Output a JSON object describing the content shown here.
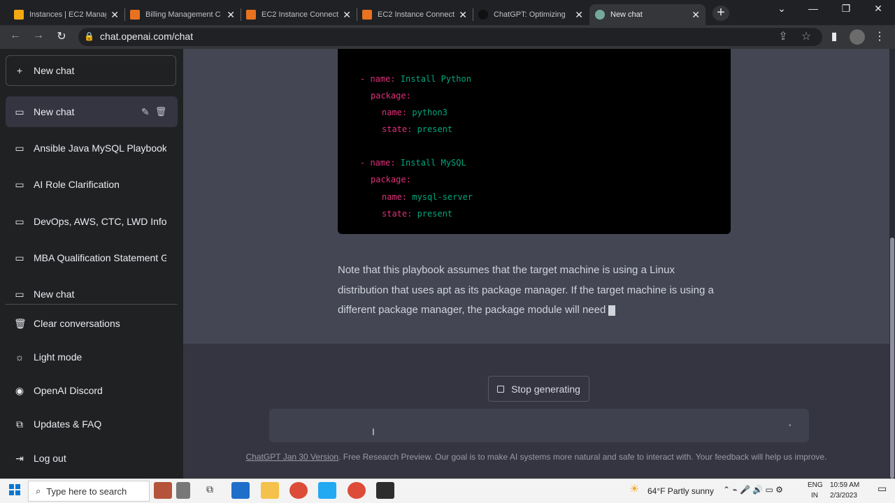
{
  "browser": {
    "tabs": [
      {
        "title": "Instances | EC2 Manag",
        "icon": "aws-icon",
        "color": "#f3a712"
      },
      {
        "title": "Billing Management C",
        "icon": "aws-icon",
        "color": "#e8721f"
      },
      {
        "title": "EC2 Instance Connect",
        "icon": "aws-icon",
        "color": "#e8721f"
      },
      {
        "title": "EC2 Instance Connect",
        "icon": "aws-icon",
        "color": "#e8721f"
      },
      {
        "title": "ChatGPT: Optimizing",
        "icon": "openai-icon",
        "color": "#111111"
      },
      {
        "title": "New chat",
        "icon": "chatgpt-icon",
        "color": "#74aa9c",
        "active": true
      }
    ],
    "url": "chat.openai.com/chat"
  },
  "sidebar": {
    "new_chat": "New chat",
    "conversations": [
      {
        "label": "New chat",
        "selected": true
      },
      {
        "label": "Ansible Java MySQL Playbook"
      },
      {
        "label": "AI Role Clarification"
      },
      {
        "label": "DevOps, AWS, CTC, LWD Info"
      },
      {
        "label": "MBA Qualification Statement G"
      },
      {
        "label": "New chat"
      }
    ],
    "actions": [
      {
        "label": "Clear conversations",
        "icon": "trash-icon"
      },
      {
        "label": "Light mode",
        "icon": "sun-icon"
      },
      {
        "label": "OpenAI Discord",
        "icon": "discord-icon"
      },
      {
        "label": "Updates & FAQ",
        "icon": "external-link-icon"
      },
      {
        "label": "Log out",
        "icon": "logout-icon"
      }
    ]
  },
  "code": {
    "lines": [
      {
        "dash": "- ",
        "key": "name:",
        "val": " Install Python",
        "indent": 0
      },
      {
        "key": "package:",
        "val": "",
        "indent": 1
      },
      {
        "key": "name:",
        "val": " python3",
        "indent": 2
      },
      {
        "key": "state:",
        "val": " present",
        "indent": 2
      },
      {
        "dash": "- ",
        "key": "name:",
        "val": " Install MySQL",
        "indent": 0
      },
      {
        "key": "package:",
        "val": "",
        "indent": 1
      },
      {
        "key": "name:",
        "val": " mysql-server",
        "indent": 2
      },
      {
        "key": "state:",
        "val": " present",
        "indent": 2
      }
    ]
  },
  "response": {
    "text": "Note that this playbook assumes that the target machine is using a Linux distribution that uses apt as its package manager. If the target machine is using a different package manager, the package module will need"
  },
  "controls": {
    "stop_generating": "Stop generating",
    "input_value": ""
  },
  "footer": {
    "link": "ChatGPT Jan 30 Version",
    "text": ". Free Research Preview. Our goal is to make AI systems more natural and safe to interact with. Your feedback will help us improve."
  },
  "taskbar": {
    "search_placeholder": "Type here to search",
    "weather": "64°F  Partly sunny",
    "lang": "ENG",
    "region": "IN",
    "time": "10:59 AM",
    "date": "2/3/2023"
  }
}
